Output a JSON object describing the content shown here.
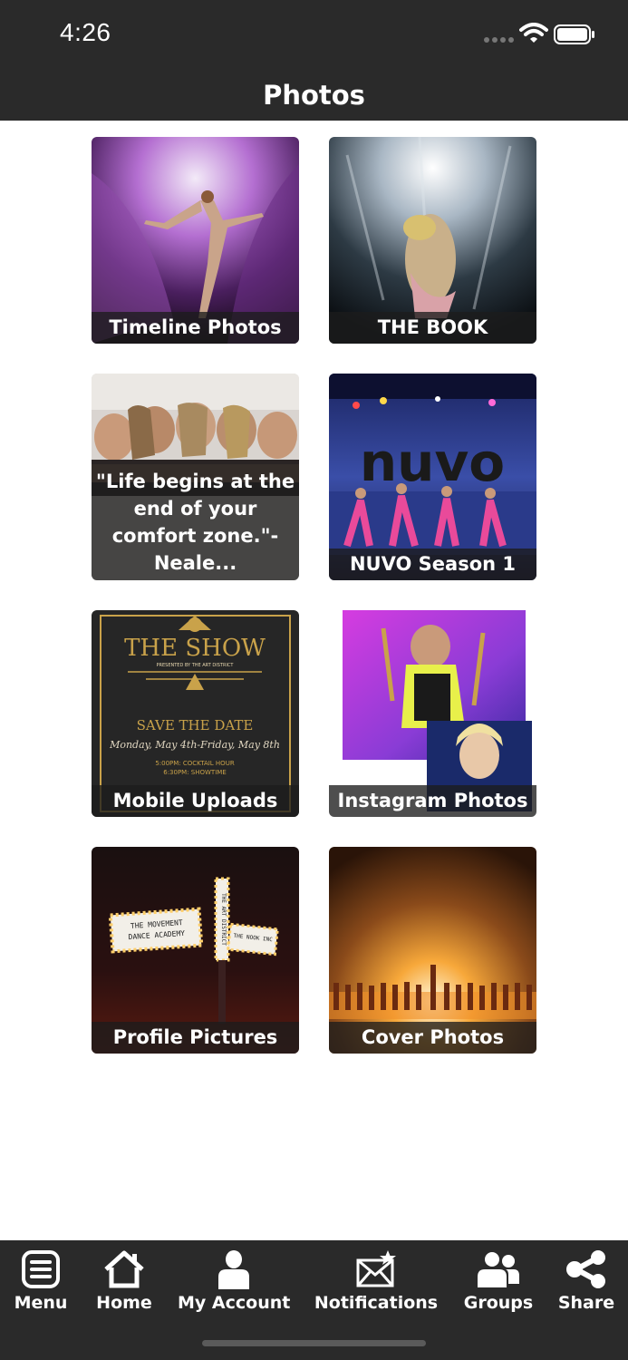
{
  "status_bar": {
    "time": "4:26"
  },
  "header": {
    "title": "Photos"
  },
  "albums": [
    {
      "title": "Timeline Photos"
    },
    {
      "title": "THE BOOK"
    },
    {
      "title": "\"Life begins at the end of your comfort zone.\"- Neale..."
    },
    {
      "title": "NUVO Season 1"
    },
    {
      "title": "Mobile Uploads"
    },
    {
      "title": "Instagram Photos"
    },
    {
      "title": "Profile Pictures"
    },
    {
      "title": "Cover Photos"
    }
  ],
  "album_art_text": {
    "nuvo_logo": "nuvo",
    "show_title": "THE SHOW",
    "show_presenter": "PRESENTED BY THE ART DISTRICT",
    "save_the_date": "SAVE THE DATE",
    "show_dates": "Monday, May 4th-Friday, May 8th",
    "cocktail_hour": "5:00PM: COCKTAIL HOUR",
    "showtime": "6:30PM: SHOWTIME",
    "marquee_left_1": "THE MOVEMENT",
    "marquee_left_2": "DANCE ACADEMY",
    "marquee_vertical": "THE ART DISTRICT",
    "marquee_right": "THE NOOK INC"
  },
  "tab_bar": {
    "items": [
      {
        "label": "Menu",
        "icon": "menu-icon"
      },
      {
        "label": "Home",
        "icon": "home-icon"
      },
      {
        "label": "My Account",
        "icon": "user-icon"
      },
      {
        "label": "Notifications",
        "icon": "notifications-icon"
      },
      {
        "label": "Groups",
        "icon": "groups-icon"
      },
      {
        "label": "Share",
        "icon": "share-icon"
      }
    ]
  },
  "colors": {
    "bar_background": "#2a2a2a",
    "caption_background": "#1c1c1c",
    "text": "#ffffff"
  }
}
